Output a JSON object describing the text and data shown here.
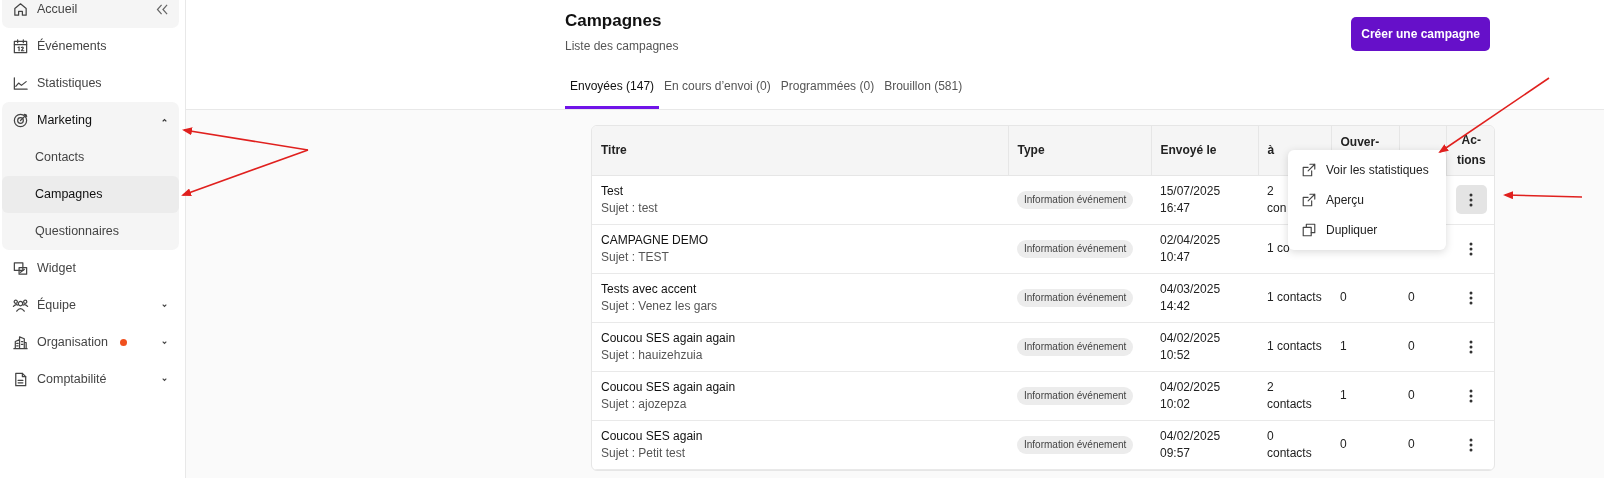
{
  "sidebar": {
    "items": [
      {
        "label": "Accueil",
        "kind": "home",
        "hovered": true,
        "collapse_control": true
      },
      {
        "label": "Événements",
        "kind": "calendar"
      },
      {
        "label": "Statistiques",
        "kind": "chart"
      },
      {
        "label": "Marketing",
        "kind": "target",
        "expanded": true,
        "children": [
          {
            "label": "Contacts",
            "selected": false
          },
          {
            "label": "Campagnes",
            "selected": true
          },
          {
            "label": "Questionnaires",
            "selected": false
          }
        ]
      },
      {
        "label": "Widget",
        "kind": "widget"
      },
      {
        "label": "Équipe",
        "kind": "team",
        "expanded": false
      },
      {
        "label": "Organisation",
        "kind": "building",
        "expanded": false,
        "color": "#f0501e"
      },
      {
        "label": "Comptabilité",
        "kind": "document",
        "expanded": false
      }
    ]
  },
  "header": {
    "title": "Campagnes",
    "subtitle": "Liste des campagnes",
    "create_button": "Créer une campagne"
  },
  "tabs": [
    {
      "label": "Envoyées (147)",
      "selected": true
    },
    {
      "label": "En cours d’envoi (0)",
      "selected": false
    },
    {
      "label": "Programmées (0)",
      "selected": false
    },
    {
      "label": "Brouillon (581)",
      "selected": false
    }
  ],
  "table": {
    "columns": [
      "Titre",
      "Type",
      "Envoyé le",
      "à",
      "Ouver-",
      "",
      "Ac- tions"
    ],
    "rows": [
      {
        "title": "Test",
        "subject": "Sujet : test",
        "type": "Information événement",
        "sent": [
          "15/07/2025",
          "16:47"
        ],
        "recipients": [
          "2",
          "con"
        ],
        "actions_open": true
      },
      {
        "title": "CAMPAGNE DEMO",
        "subject": "Sujet : TEST",
        "type": "Information événement",
        "sent": [
          "02/04/2025",
          "10:47"
        ],
        "recipients": [
          "1 co"
        ],
        "actions_open": false
      },
      {
        "title": "Tests avec accent",
        "subject": "Sujet : Venez les gars",
        "type": "Information événement",
        "sent": [
          "04/03/2025",
          "14:42"
        ],
        "recipients": [
          "1 contacts"
        ],
        "opens": "0",
        "clicks": "0",
        "actions_open": false
      },
      {
        "title": "Coucou SES again again",
        "subject": "Sujet : hauizehzuia",
        "type": "Information événement",
        "sent": [
          "04/02/2025",
          "10:52"
        ],
        "recipients": [
          "1 contacts"
        ],
        "opens": "1",
        "clicks": "0",
        "actions_open": false
      },
      {
        "title": "Coucou SES again again",
        "subject": "Sujet : ajozepza",
        "type": "Information événement",
        "sent": [
          "04/02/2025",
          "10:02"
        ],
        "recipients": [
          "2",
          "contacts"
        ],
        "opens": "1",
        "clicks": "0",
        "actions_open": false
      },
      {
        "title": "Coucou SES again",
        "subject": "Sujet : Petit test",
        "type": "Information événement",
        "sent": [
          "04/02/2025",
          "09:57"
        ],
        "recipients": [
          "0",
          "contacts"
        ],
        "opens": "0",
        "clicks": "0",
        "actions_open": false
      }
    ]
  },
  "actions_menu": {
    "items": [
      {
        "label": "Voir les statistiques",
        "kind": "external"
      },
      {
        "label": "Aperçu",
        "kind": "external"
      },
      {
        "label": "Dupliquer",
        "kind": "copy"
      }
    ]
  }
}
